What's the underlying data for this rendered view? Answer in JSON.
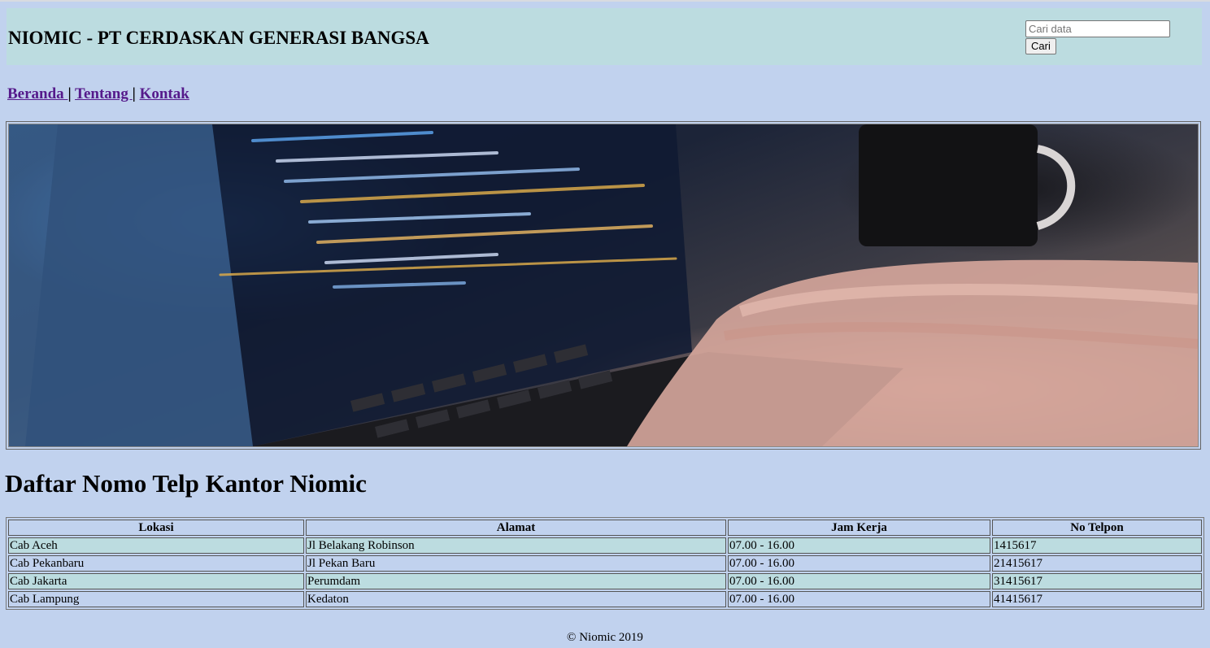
{
  "header": {
    "title": "NIOMIC - PT CERDASKAN GENERASI BANGSA",
    "search_placeholder": "Cari data",
    "search_button": "Cari"
  },
  "nav": {
    "items": [
      {
        "label": "Beranda "
      },
      {
        "label": "Tentang "
      },
      {
        "label": "Kontak"
      }
    ],
    "separator": "|"
  },
  "banner": {
    "icon": "laptop-coding-photo"
  },
  "heading": "Daftar Nomo Telp Kantor Niomic",
  "table": {
    "headers": [
      "Lokasi",
      "Alamat",
      "Jam Kerja",
      "No Telpon"
    ],
    "rows": [
      [
        "Cab Aceh",
        "Jl Belakang Robinson",
        "07.00 - 16.00",
        "1415617"
      ],
      [
        "Cab Pekanbaru",
        "Jl Pekan Baru",
        "07.00 - 16.00",
        "21415617"
      ],
      [
        "Cab Jakarta",
        "Perumdam",
        "07.00 - 16.00",
        "31415617"
      ],
      [
        "Cab Lampung",
        "Kedaton",
        "07.00 - 16.00",
        "41415617"
      ]
    ]
  },
  "footer": "© Niomic 2019",
  "colors": {
    "page_bg": "#c1d2ee",
    "header_bg": "#bcdce0",
    "link": "#551a8b"
  }
}
